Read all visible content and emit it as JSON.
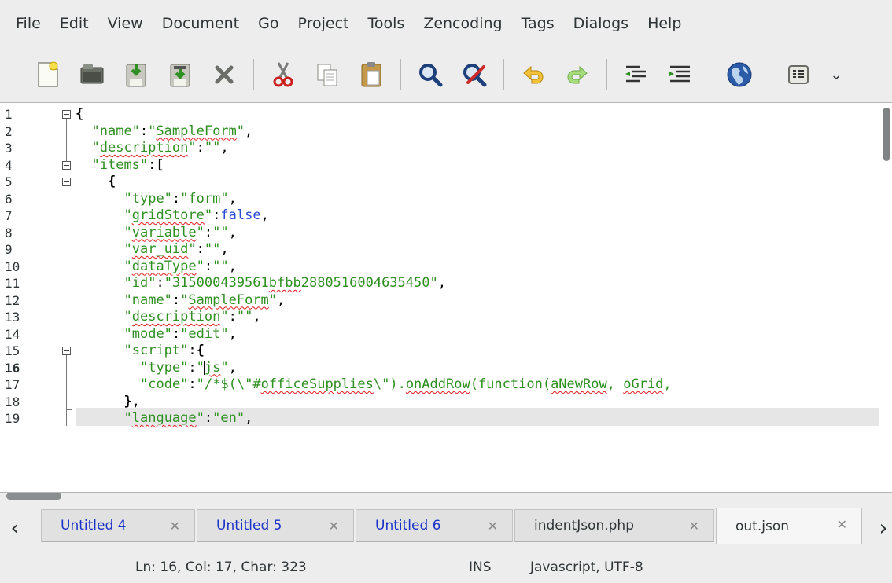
{
  "menu": [
    "File",
    "Edit",
    "View",
    "Document",
    "Go",
    "Project",
    "Tools",
    "Zencoding",
    "Tags",
    "Dialogs",
    "Help"
  ],
  "toolbar": {
    "buttons": [
      "new-file",
      "open-file",
      "save-file",
      "save-as",
      "close-file",
      "cut",
      "copy",
      "paste",
      "find",
      "replace",
      "undo",
      "redo",
      "unindent",
      "indent",
      "preview-in-browser",
      "show-hidden"
    ],
    "more": "⌄"
  },
  "editor": {
    "current_line": 16,
    "line_numbers": [
      "1",
      "2",
      "3",
      "4",
      "5",
      "6",
      "7",
      "8",
      "9",
      "10",
      "11",
      "12",
      "13",
      "14",
      "15",
      "16",
      "17",
      "18",
      "19"
    ],
    "lines": [
      "{",
      "  \"name\":\"SampleForm\",",
      "  \"description\":\"\",",
      "  \"items\":[",
      "    {",
      "      \"type\":\"form\",",
      "      \"gridStore\":false,",
      "      \"variable\":\"\",",
      "      \"var_uid\":\"\",",
      "      \"dataType\":\"\",",
      "      \"id\":\"315000439561bfbb2880516004635450\",",
      "      \"name\":\"SampleForm\",",
      "      \"description\":\"\",",
      "      \"mode\":\"edit\",",
      "      \"script\":{",
      "        \"type\":\"js\",",
      "        \"code\":\"/*$(\\\"#officeSupplies\\\").onAddRow(function(aNewRow, oGrid,",
      "      },",
      "      \"language\":\"en\","
    ]
  },
  "tabs": [
    {
      "label": "Untitled 4",
      "style": "blue"
    },
    {
      "label": "Untitled 5",
      "style": "blue"
    },
    {
      "label": "Untitled 6",
      "style": "blue"
    },
    {
      "label": "indentJson.php",
      "style": "normal"
    },
    {
      "label": "out.json",
      "style": "normal",
      "active": true
    }
  ],
  "tab_close_glyph": "✕",
  "tab_left_arrow": "‹",
  "tab_right_arrow": "›",
  "status": {
    "position": "Ln: 16, Col: 17, Char: 323",
    "mode": "INS",
    "type": "Javascript, UTF-8"
  }
}
